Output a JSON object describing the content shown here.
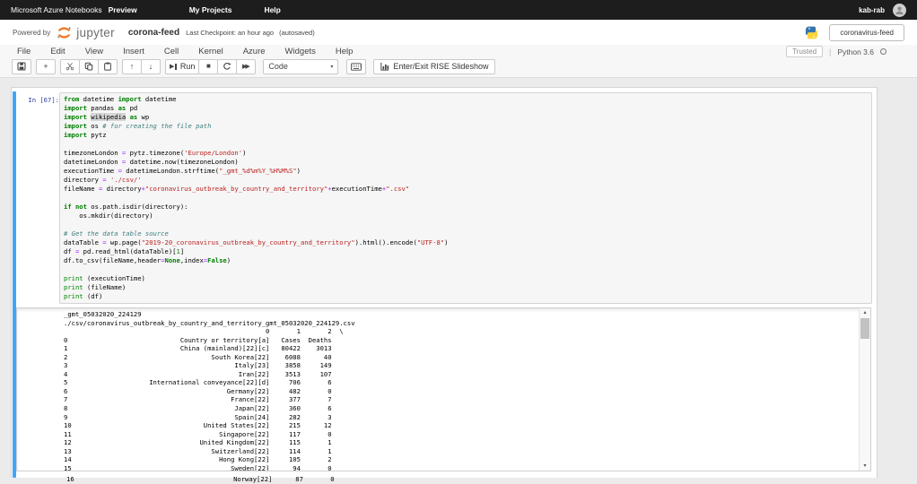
{
  "topbar": {
    "brand": "Microsoft Azure Notebooks",
    "preview": "Preview",
    "my_projects": "My Projects",
    "help": "Help",
    "user": "kab-rab"
  },
  "header": {
    "powered_by": "Powered by",
    "logo_text": "jupyter",
    "notebook_name": "corona-feed",
    "checkpoint": "Last Checkpoint: an hour ago",
    "autosaved": "(autosaved)",
    "project_button": "coronavirus-feed"
  },
  "menubar": {
    "items": [
      "File",
      "Edit",
      "View",
      "Insert",
      "Cell",
      "Kernel",
      "Azure",
      "Widgets",
      "Help"
    ],
    "trusted": "Trusted",
    "kernel_name": "Python 3.6"
  },
  "toolbar": {
    "run_label": "Run",
    "cell_type": "Code",
    "rise_label": "Enter/Exit RISE Slideshow"
  },
  "glyphs": {
    "add": "+",
    "move_up": "↑",
    "move_down": "↓",
    "play": "▶",
    "stop": "■",
    "fast_forward": "▶▶",
    "dropdown": "▾",
    "scroll_up": "▴",
    "scroll_down": "▾"
  },
  "colors": {
    "jupyter_orange": "#f37726",
    "selection_blue": "#42a5f5",
    "python_blue": "#3776ab",
    "python_yellow": "#ffd43b"
  },
  "cell": {
    "prompt": "In [67]:",
    "code_lines": [
      [
        [
          "k",
          "from"
        ],
        [
          "t",
          " datetime "
        ],
        [
          "k",
          "import"
        ],
        [
          "t",
          " datetime"
        ]
      ],
      [
        [
          "k",
          "import"
        ],
        [
          "t",
          " pandas "
        ],
        [
          "k",
          "as"
        ],
        [
          "t",
          " pd"
        ]
      ],
      [
        [
          "k",
          "import"
        ],
        [
          "t",
          " "
        ],
        [
          "hl",
          "wikipedia"
        ],
        [
          "t",
          " "
        ],
        [
          "k",
          "as"
        ],
        [
          "t",
          " wp"
        ]
      ],
      [
        [
          "k",
          "import"
        ],
        [
          "t",
          " os "
        ],
        [
          "c",
          "# for creating the file path"
        ]
      ],
      [
        [
          "k",
          "import"
        ],
        [
          "t",
          " pytz"
        ]
      ],
      [],
      [
        [
          "t",
          "timezoneLondon "
        ],
        [
          "o",
          "="
        ],
        [
          "t",
          " pytz.timezone("
        ],
        [
          "s",
          "'Europe/London'"
        ],
        [
          "t",
          ")"
        ]
      ],
      [
        [
          "t",
          "datetimeLondon "
        ],
        [
          "o",
          "="
        ],
        [
          "t",
          " datetime.now(timezoneLondon)"
        ]
      ],
      [
        [
          "t",
          "executionTime "
        ],
        [
          "o",
          "="
        ],
        [
          "t",
          " datetimeLondon.strftime("
        ],
        [
          "s",
          "\"_gmt_%d%m%Y_%H%M%S\""
        ],
        [
          "t",
          ")"
        ]
      ],
      [
        [
          "t",
          "directory "
        ],
        [
          "o",
          "="
        ],
        [
          "t",
          " "
        ],
        [
          "s",
          "'./csv/'"
        ]
      ],
      [
        [
          "t",
          "fileName "
        ],
        [
          "o",
          "="
        ],
        [
          "t",
          " directory"
        ],
        [
          "o",
          "+"
        ],
        [
          "s",
          "\"coronavirus_outbreak_by_country_and_territory\""
        ],
        [
          "o",
          "+"
        ],
        [
          "t",
          "executionTime"
        ],
        [
          "o",
          "+"
        ],
        [
          "s",
          "\".csv\""
        ]
      ],
      [],
      [
        [
          "k",
          "if"
        ],
        [
          "t",
          " "
        ],
        [
          "k",
          "not"
        ],
        [
          "t",
          " os.path.isdir(directory):"
        ]
      ],
      [
        [
          "t",
          "    os.mkdir(directory)"
        ]
      ],
      [],
      [
        [
          "c",
          "# Get the data table source"
        ]
      ],
      [
        [
          "t",
          "dataTable "
        ],
        [
          "o",
          "="
        ],
        [
          "t",
          " wp.page("
        ],
        [
          "s",
          "\"2019-20_coronavirus_outbreak_by_country_and_territory\""
        ],
        [
          "t",
          ").html().encode("
        ],
        [
          "s",
          "\"UTF-8\""
        ],
        [
          "t",
          ")"
        ]
      ],
      [
        [
          "t",
          "df "
        ],
        [
          "o",
          "="
        ],
        [
          "t",
          " pd.read_html(dataTable)["
        ],
        [
          "n",
          "1"
        ],
        [
          "t",
          "]"
        ]
      ],
      [
        [
          "t",
          "df.to_csv(fileName,header"
        ],
        [
          "o",
          "="
        ],
        [
          "k",
          "None"
        ],
        [
          "t",
          ",index"
        ],
        [
          "o",
          "="
        ],
        [
          "k",
          "False"
        ],
        [
          "t",
          ")"
        ]
      ],
      [],
      [
        [
          "b",
          "print"
        ],
        [
          "t",
          " (executionTime)"
        ]
      ],
      [
        [
          "b",
          "print"
        ],
        [
          "t",
          " (fileName)"
        ]
      ],
      [
        [
          "b",
          "print"
        ],
        [
          "t",
          " (df)"
        ]
      ]
    ]
  },
  "output": {
    "exec_time": "_gmt_05032020_224129",
    "file_path": "./csv/coronavirus_outbreak_by_country_and_territory_gmt_05032020_224129.csv",
    "table": {
      "col_headers": [
        "0",
        "1",
        "2"
      ],
      "continuation": "\\",
      "rows": [
        [
          "0",
          "Country or territory[a]",
          "Cases",
          "Deaths"
        ],
        [
          "1",
          "China (mainland)[22][c]",
          "80422",
          "3013"
        ],
        [
          "2",
          "South Korea[22]",
          "6088",
          "40"
        ],
        [
          "3",
          "Italy[23]",
          "3858",
          "149"
        ],
        [
          "4",
          "Iran[22]",
          "3513",
          "107"
        ],
        [
          "5",
          "International conveyance[22][d]",
          "706",
          "6"
        ],
        [
          "6",
          "Germany[22]",
          "482",
          "0"
        ],
        [
          "7",
          "France[22]",
          "377",
          "7"
        ],
        [
          "8",
          "Japan[22]",
          "360",
          "6"
        ],
        [
          "9",
          "Spain[24]",
          "282",
          "3"
        ],
        [
          "10",
          "United States[22]",
          "215",
          "12"
        ],
        [
          "11",
          "Singapore[22]",
          "117",
          "0"
        ],
        [
          "12",
          "United Kingdom[22]",
          "115",
          "1"
        ],
        [
          "13",
          "Switzerland[22]",
          "114",
          "1"
        ],
        [
          "14",
          "Hong Kong[22]",
          "105",
          "2"
        ],
        [
          "15",
          "Sweden[22]",
          "94",
          "0"
        ]
      ],
      "clipped_row": [
        "16",
        "Norway[22]",
        "87",
        "0"
      ]
    }
  }
}
